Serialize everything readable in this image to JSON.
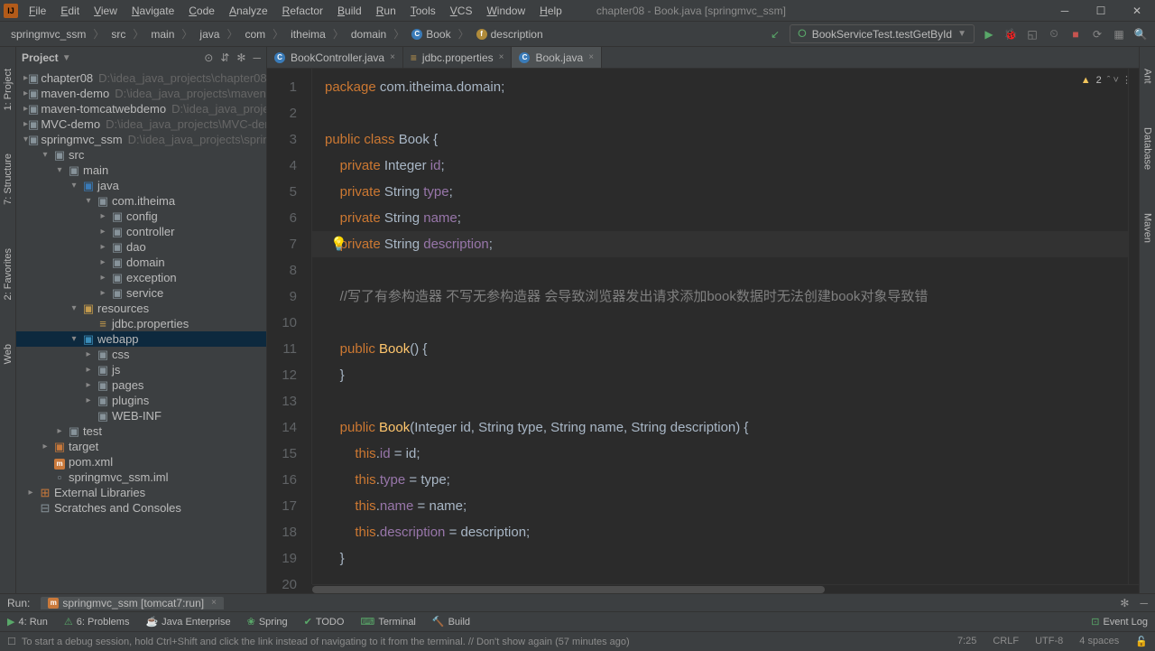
{
  "title": "chapter08 - Book.java [springmvc_ssm]",
  "menu": [
    "File",
    "Edit",
    "View",
    "Navigate",
    "Code",
    "Analyze",
    "Refactor",
    "Build",
    "Run",
    "Tools",
    "VCS",
    "Window",
    "Help"
  ],
  "breadcrumbs": [
    "springmvc_ssm",
    "src",
    "main",
    "java",
    "com",
    "itheima",
    "domain",
    "Book",
    "description"
  ],
  "runConfig": "BookServiceTest.testGetById",
  "projectLabel": "Project",
  "tree": [
    {
      "d": 0,
      "chev": ">",
      "icon": "folder",
      "label": "chapter08",
      "path": "D:\\idea_java_projects\\chapter08"
    },
    {
      "d": 0,
      "chev": ">",
      "icon": "folder",
      "label": "maven-demo",
      "path": "D:\\idea_java_projects\\maven-dem"
    },
    {
      "d": 0,
      "chev": ">",
      "icon": "folder",
      "label": "maven-tomcatwebdemo",
      "path": "D:\\idea_java_projects"
    },
    {
      "d": 0,
      "chev": ">",
      "icon": "folder",
      "label": "MVC-demo",
      "path": "D:\\idea_java_projects\\MVC-demo"
    },
    {
      "d": 0,
      "chev": "v",
      "icon": "folder",
      "label": "springmvc_ssm",
      "path": "D:\\idea_java_projects\\springm"
    },
    {
      "d": 1,
      "chev": "v",
      "icon": "folder",
      "label": "src",
      "path": ""
    },
    {
      "d": 2,
      "chev": "v",
      "icon": "folder",
      "label": "main",
      "path": ""
    },
    {
      "d": 3,
      "chev": "v",
      "icon": "folder-src",
      "label": "java",
      "path": ""
    },
    {
      "d": 4,
      "chev": "v",
      "icon": "folder",
      "label": "com.itheima",
      "path": ""
    },
    {
      "d": 5,
      "chev": ">",
      "icon": "folder",
      "label": "config",
      "path": ""
    },
    {
      "d": 5,
      "chev": ">",
      "icon": "folder",
      "label": "controller",
      "path": ""
    },
    {
      "d": 5,
      "chev": ">",
      "icon": "folder",
      "label": "dao",
      "path": ""
    },
    {
      "d": 5,
      "chev": ">",
      "icon": "folder",
      "label": "domain",
      "path": ""
    },
    {
      "d": 5,
      "chev": ">",
      "icon": "folder",
      "label": "exception",
      "path": ""
    },
    {
      "d": 5,
      "chev": ">",
      "icon": "folder",
      "label": "service",
      "path": ""
    },
    {
      "d": 3,
      "chev": "v",
      "icon": "folder-res",
      "label": "resources",
      "path": ""
    },
    {
      "d": 4,
      "chev": "",
      "icon": "prop",
      "label": "jdbc.properties",
      "path": ""
    },
    {
      "d": 3,
      "chev": "v",
      "icon": "folder-web",
      "label": "webapp",
      "path": "",
      "selected": true
    },
    {
      "d": 4,
      "chev": ">",
      "icon": "folder",
      "label": "css",
      "path": ""
    },
    {
      "d": 4,
      "chev": ">",
      "icon": "folder",
      "label": "js",
      "path": ""
    },
    {
      "d": 4,
      "chev": ">",
      "icon": "folder",
      "label": "pages",
      "path": ""
    },
    {
      "d": 4,
      "chev": ">",
      "icon": "folder",
      "label": "plugins",
      "path": ""
    },
    {
      "d": 4,
      "chev": "",
      "icon": "folder",
      "label": "WEB-INF",
      "path": ""
    },
    {
      "d": 2,
      "chev": ">",
      "icon": "folder",
      "label": "test",
      "path": ""
    },
    {
      "d": 1,
      "chev": ">",
      "icon": "folder-orange",
      "label": "target",
      "path": ""
    },
    {
      "d": 1,
      "chev": "",
      "icon": "maven",
      "label": "pom.xml",
      "path": ""
    },
    {
      "d": 1,
      "chev": "",
      "icon": "file",
      "label": "springmvc_ssm.iml",
      "path": ""
    },
    {
      "d": 0,
      "chev": ">",
      "icon": "lib",
      "label": "External Libraries",
      "path": ""
    },
    {
      "d": 0,
      "chev": "",
      "icon": "scratch",
      "label": "Scratches and Consoles",
      "path": ""
    }
  ],
  "tabs": [
    {
      "label": "BookController.java",
      "icon": "c",
      "active": false
    },
    {
      "label": "jdbc.properties",
      "icon": "prop",
      "active": false
    },
    {
      "label": "Book.java",
      "icon": "c",
      "active": true
    }
  ],
  "inspection": {
    "warnings": "2"
  },
  "code": {
    "lines": 20,
    "content": [
      {
        "n": 1,
        "html": "<span class='kw'>package</span> com.itheima.domain;"
      },
      {
        "n": 2,
        "html": ""
      },
      {
        "n": 3,
        "html": "<span class='kw'>public class</span> Book {"
      },
      {
        "n": 4,
        "html": "    <span class='kw'>private</span> Integer <span class='field'>id</span>;"
      },
      {
        "n": 5,
        "html": "    <span class='kw'>private</span> String <span class='field'>type</span>;"
      },
      {
        "n": 6,
        "html": "    <span class='kw'>private</span> String <span class='field'>name</span>;"
      },
      {
        "n": 7,
        "html": "    <span class='kw'>private</span> String <span class='field'>description</span>;",
        "hl": true,
        "bulb": true
      },
      {
        "n": 8,
        "html": ""
      },
      {
        "n": 9,
        "html": "    <span class='comment'>//写了有参构造器 不写无参构造器 会导致浏览器发出请求添加book数据时无法创建book对象导致错</span>"
      },
      {
        "n": 10,
        "html": ""
      },
      {
        "n": 11,
        "html": "    <span class='kw'>public</span> <span class='fn'>Book</span>() {"
      },
      {
        "n": 12,
        "html": "    }"
      },
      {
        "n": 13,
        "html": ""
      },
      {
        "n": 14,
        "html": "    <span class='kw'>public</span> <span class='fn'>Book</span>(Integer id, String type, String name, String description) {"
      },
      {
        "n": 15,
        "html": "        <span class='kw'>this</span>.<span class='field'>id</span> = id;"
      },
      {
        "n": 16,
        "html": "        <span class='kw'>this</span>.<span class='field'>type</span> = type;"
      },
      {
        "n": 17,
        "html": "        <span class='kw'>this</span>.<span class='field'>name</span> = name;"
      },
      {
        "n": 18,
        "html": "        <span class='kw'>this</span>.<span class='field'>description</span> = description;"
      },
      {
        "n": 19,
        "html": "    }"
      },
      {
        "n": 20,
        "html": ""
      }
    ]
  },
  "leftTabs": [
    "1: Project",
    "7: Structure",
    "2: Favorites",
    "Web"
  ],
  "rightTabs": [
    "Ant",
    "Database",
    "Maven"
  ],
  "runBar": {
    "label": "Run:",
    "tab": "springmvc_ssm [tomcat7:run]"
  },
  "bottomTabs": [
    "4: Run",
    "6: Problems",
    "Java Enterprise",
    "Spring",
    "TODO",
    "Terminal",
    "Build"
  ],
  "eventLog": "Event Log",
  "statusMsg": "To start a debug session, hold Ctrl+Shift and click the link instead of navigating to it from the terminal. // Don't show again (57 minutes ago)",
  "statusRight": [
    "7:25",
    "CRLF",
    "UTF-8",
    "4 spaces"
  ]
}
